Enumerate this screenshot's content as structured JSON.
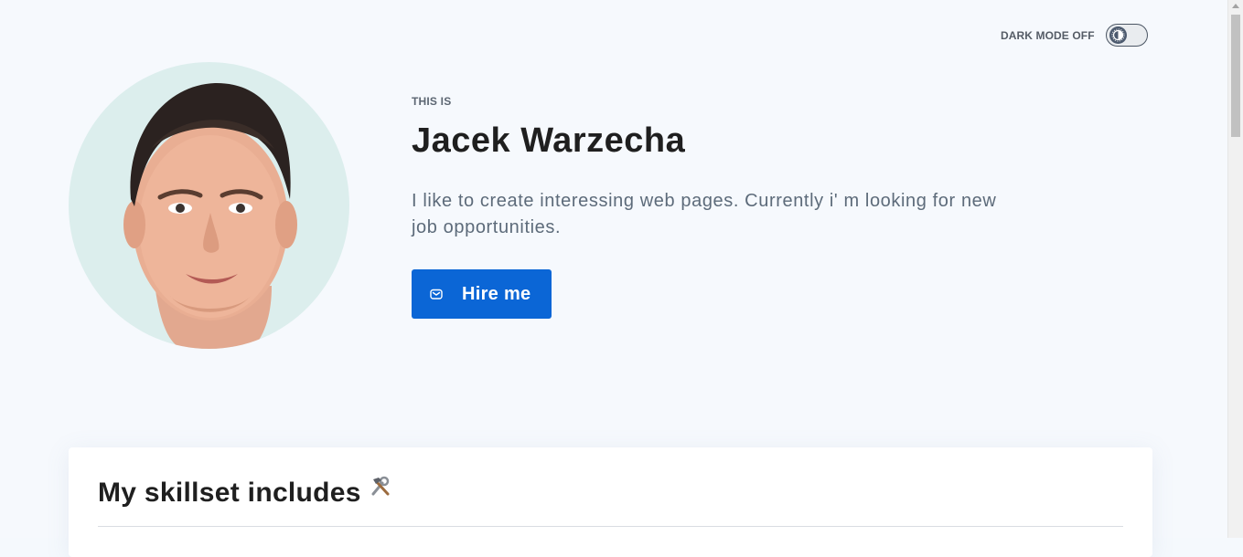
{
  "header": {
    "dark_mode_label": "DARK MODE OFF",
    "dark_mode_on": false
  },
  "hero": {
    "eyebrow": "THIS IS",
    "name": "Jacek Warzecha",
    "bio": "I like to create interessing web pages. Currently i' m looking for new job opportunities.",
    "hire_button_label": "Hire me",
    "hire_icon": "mail-icon"
  },
  "skills": {
    "title": "My skillset includes",
    "title_icon": "tools-icon"
  },
  "colors": {
    "accent": "#0b66d6",
    "background": "#f6f9fd",
    "avatar_bg": "#dceeed",
    "heading": "#1f1f1f",
    "muted": "#5d6b7a"
  }
}
